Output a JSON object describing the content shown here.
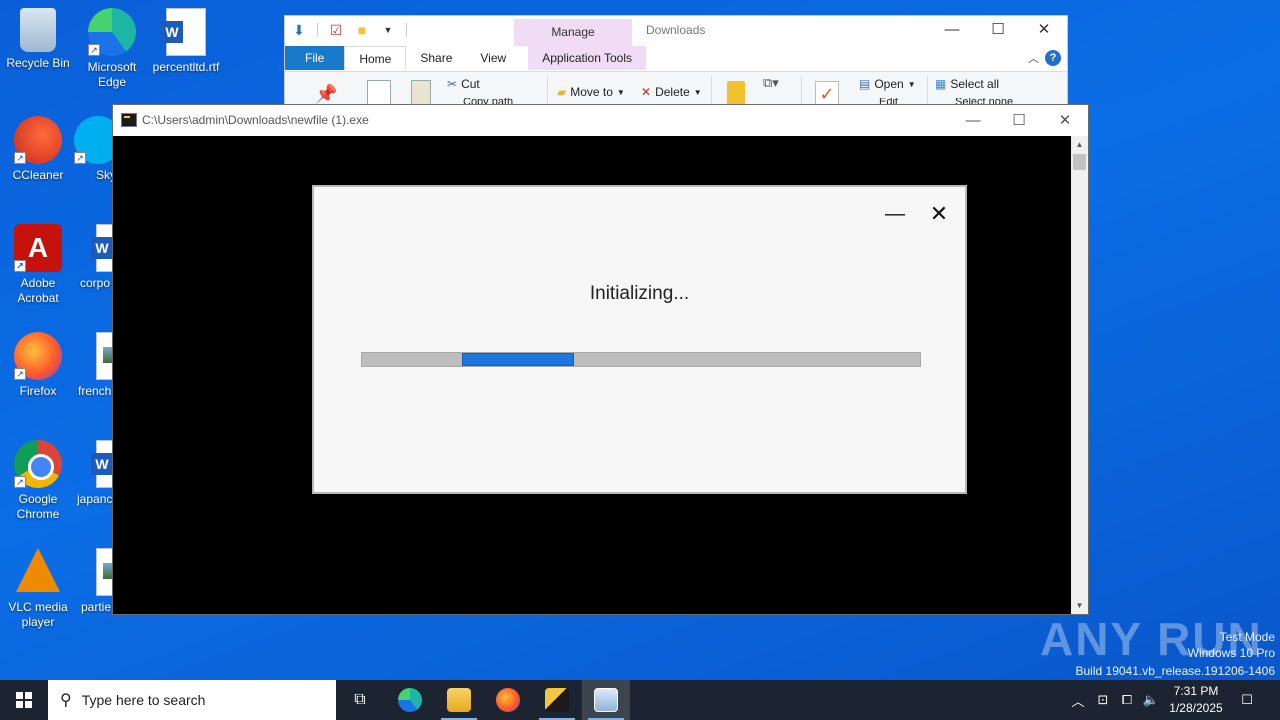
{
  "desktop": {
    "icons": [
      {
        "label": "Recycle Bin",
        "icon": "recycle-bin-icon"
      },
      {
        "label": "Microsoft Edge",
        "icon": "edge-icon"
      },
      {
        "label": "percentltd.rtf",
        "icon": "word-document-icon"
      },
      {
        "label": "CCleaner",
        "icon": "ccleaner-icon"
      },
      {
        "label": "Sky",
        "icon": "skype-icon"
      },
      {
        "label": "Adobe Acrobat",
        "icon": "acrobat-icon"
      },
      {
        "label": "corpo",
        "icon": "word-document-icon"
      },
      {
        "label": "Firefox",
        "icon": "firefox-icon"
      },
      {
        "label": "french",
        "icon": "image-file-icon"
      },
      {
        "label": "Google Chrome",
        "icon": "chrome-icon"
      },
      {
        "label": "japanc",
        "icon": "word-document-icon"
      },
      {
        "label": "VLC media player",
        "icon": "vlc-icon"
      },
      {
        "label": "partie",
        "icon": "image-file-icon"
      }
    ]
  },
  "explorer": {
    "title": "Downloads",
    "context_tab": "Manage",
    "tabs": [
      "File",
      "Home",
      "Share",
      "View",
      "Application Tools"
    ],
    "ribbon": {
      "cut": "Cut",
      "copy_path": "Copy path",
      "move_to": "Move to",
      "delete": "Delete",
      "open": "Open",
      "edit": "Edit",
      "select_all": "Select all",
      "select_none": "Select none"
    }
  },
  "console": {
    "title": "C:\\Users\\admin\\Downloads\\newfile (1).exe"
  },
  "installer": {
    "status": "Initializing...",
    "progress_fill_fraction": 0.2,
    "progress_fill_offset_fraction": 0.18
  },
  "watermark": {
    "brand": "ANY RUN",
    "line1": "Test Mode",
    "line2": "Windows 10 Pro",
    "line3": "Build 19041.vb_release.191206-1406"
  },
  "taskbar": {
    "search_placeholder": "Type here to search",
    "time": "7:31 PM",
    "date": "1/28/2025"
  },
  "colors": {
    "desktop_bg": "#0b6ee6",
    "accent": "#1979ca",
    "progress": "#1e76e0",
    "manage_tab": "#f1dcf6"
  }
}
